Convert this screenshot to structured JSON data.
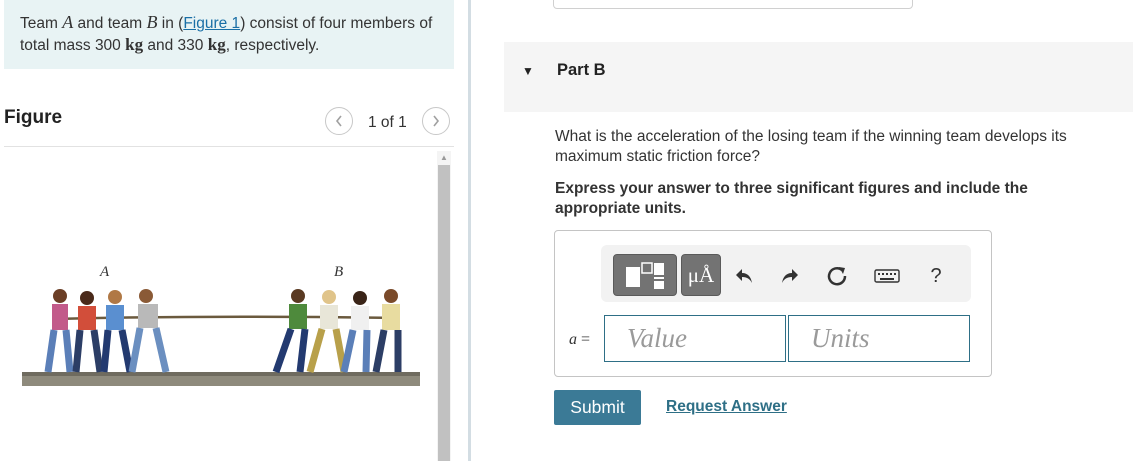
{
  "intro": {
    "pre": "Team ",
    "team_a": "A",
    "mid1": " and team ",
    "team_b": "B",
    "mid2": " in (",
    "figure_link": "Figure 1",
    "mid3": ") consist of four members of total mass 300 ",
    "unit1": "kg",
    "mid4": " and 330 ",
    "unit2": "kg",
    "end": ", respectively."
  },
  "figure": {
    "heading": "Figure",
    "pager": "1 of 1",
    "prev_icon": "chevron-left-icon",
    "next_icon": "chevron-right-icon",
    "label_a": "A",
    "label_b": "B",
    "image_subject": "tug-of-war teams A and B pulling a rope"
  },
  "part": {
    "title": "Part B",
    "caret_icon": "caret-down-icon"
  },
  "question": "What is the acceleration of the losing team if the winning team develops its maximum static friction force?",
  "instruction": "Express your answer to three significant figures and include the appropriate units.",
  "answer": {
    "equation_var": "a",
    "equation_sign": " =",
    "value_placeholder": "Value",
    "units_placeholder": "Units",
    "units_button": "μÅ",
    "help": "?"
  },
  "buttons": {
    "submit": "Submit",
    "request_answer": "Request Answer"
  },
  "colors": {
    "intro_bg": "#e8f3f4",
    "accent": "#3b7a96",
    "link": "#1a6fa6",
    "input_border": "#2e6f86"
  }
}
